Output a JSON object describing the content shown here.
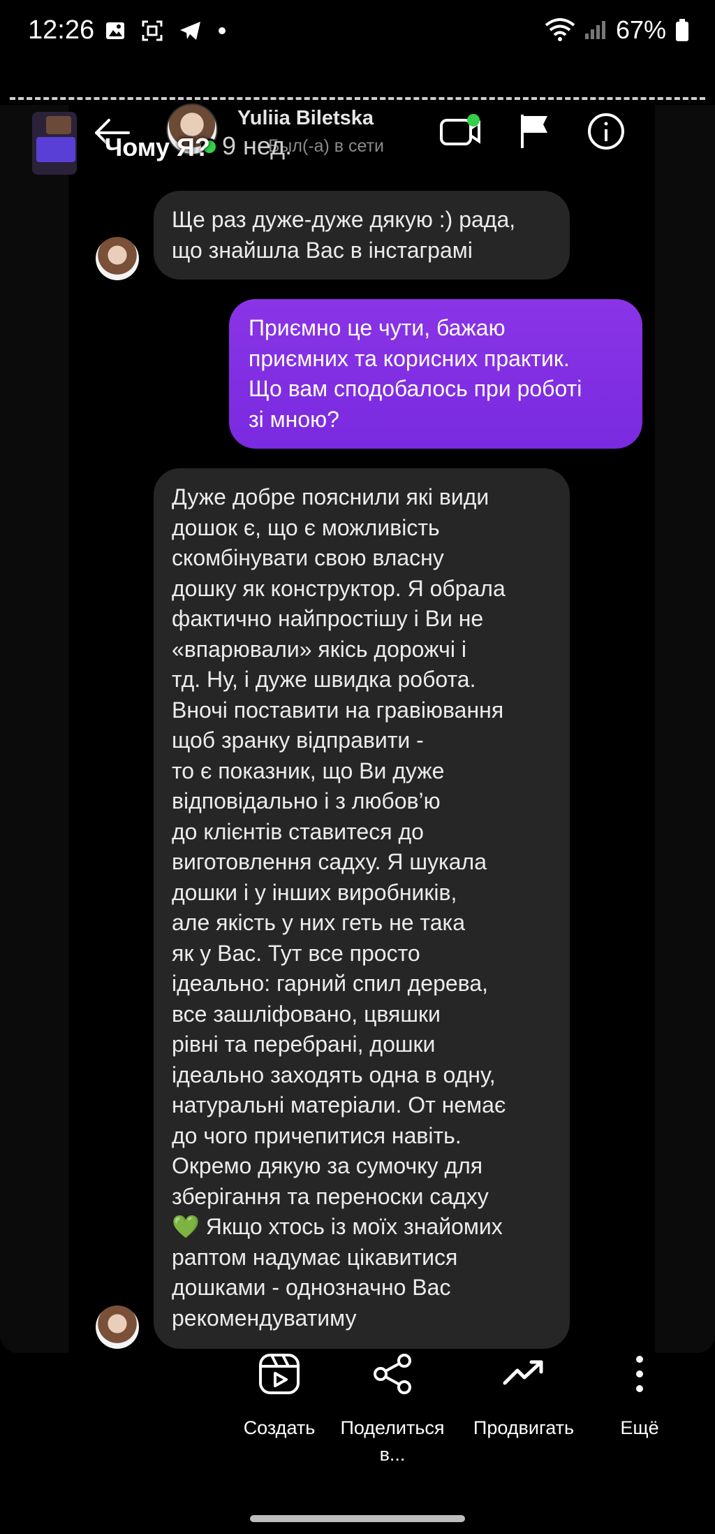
{
  "status_bar": {
    "time": "12:26",
    "battery": "67%",
    "icons": [
      "gallery-icon",
      "screenshot-icon",
      "telegram-icon",
      "dot-icon",
      "wifi-icon",
      "signal-icon",
      "battery-icon"
    ]
  },
  "overlay": {
    "title": "Чому Я?",
    "age": "9 нед."
  },
  "chat": {
    "contact_name": "Yuliia Biletska",
    "contact_status": "Был(-а) в сети",
    "messages": [
      {
        "direction": "incoming",
        "lines": [
          "Ще раз дуже-дуже дякую :) рада,",
          "що знайшла Вас в інстаграмі"
        ]
      },
      {
        "direction": "outgoing",
        "lines": [
          "Приємно це чути, бажаю",
          "приємних та корисних практик.",
          "Що вам сподобалось при роботі",
          "зі мною?"
        ]
      },
      {
        "direction": "incoming",
        "lines": [
          "Дуже добре пояснили які види",
          "дошок є, що є можливість",
          "скомбінувати свою власну",
          "дошку як конструктор. Я обрала",
          "фактично найпростішу і Ви не",
          "«впарювали» якісь дорожчі і",
          "тд. Ну, і дуже швидка робота.",
          "Вночі поставити на гравіювання",
          "щоб зранку відправити -",
          "то є показник, що Ви дуже",
          "відповідально і з любов’ю",
          "до клієнтів ставитеся до",
          "виготовлення садху. Я шукала",
          "дошки і у інших виробників,",
          "але якість у них геть не така",
          "як у Вас. Тут все просто",
          "ідеально: гарний спил дерева,",
          "все зашліфовано, цвяшки",
          "рівні та перебрані, дошки",
          "ідеально заходять одна в одну,",
          "натуральні матеріали. От немає",
          "до чого причепитися навіть.",
          "Окремо дякую за сумочку для",
          "зберігання та переноски садху",
          "Якщо хтось із моїх знайомих",
          "раптом надумає цікавитися",
          "дошками - однозначно Вас",
          "рекомендуватиму"
        ],
        "emoji_line_index": 24,
        "emoji": "💚"
      }
    ]
  },
  "bottom_actions": [
    {
      "label": "Создать",
      "icon": "reels-icon"
    },
    {
      "label": "Поделиться в...",
      "label_line1": "Поделиться",
      "label_line2": "в...",
      "icon": "share-icon"
    },
    {
      "label": "Продвигать",
      "icon": "trending-up-icon"
    },
    {
      "label": "Ещё",
      "icon": "more-vertical-icon"
    }
  ],
  "colors": {
    "outgoing_bubble": "#8a34e6",
    "incoming_bubble": "#262626",
    "online": "#35d04a"
  }
}
